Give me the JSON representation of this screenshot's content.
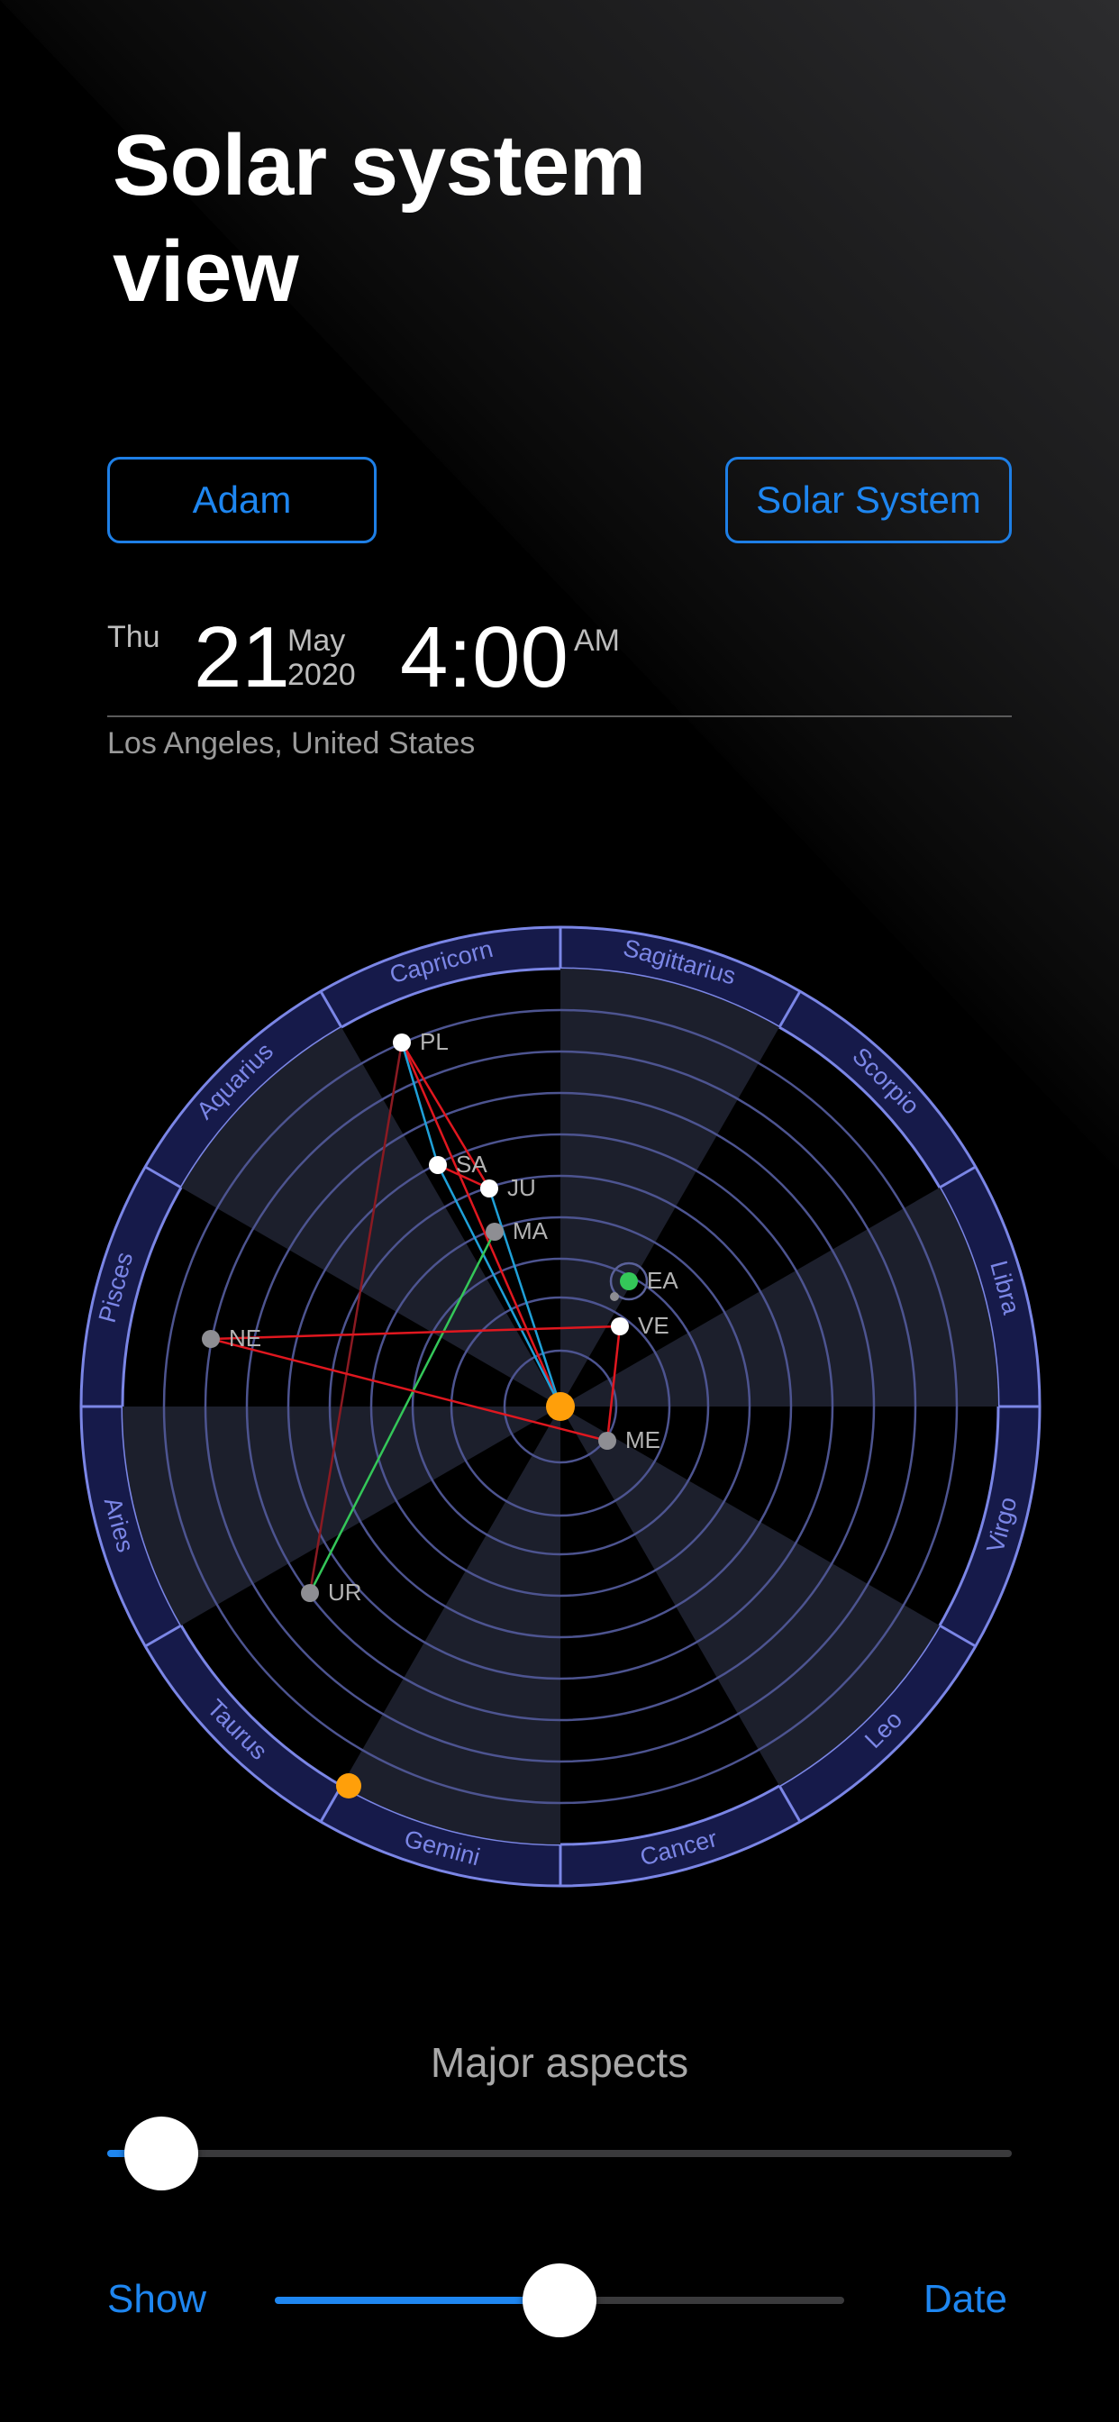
{
  "header": {
    "title_line1": "Solar system",
    "title_line2": "view"
  },
  "buttons": {
    "person": "Adam",
    "view_mode": "Solar System"
  },
  "datetime": {
    "weekday": "Thu",
    "day": "21",
    "month": "May",
    "year": "2020",
    "time": "4:00",
    "ampm": "AM"
  },
  "location": "Los Angeles, United States",
  "chart": {
    "zodiac": [
      "Capricorn",
      "Sagittarius",
      "Scorpio",
      "Libra",
      "Virgo",
      "Leo",
      "Cancer",
      "Gemini",
      "Taurus",
      "Aries",
      "Pisces",
      "Aquarius"
    ],
    "planets": [
      {
        "label": "PL",
        "color": "#ffffff"
      },
      {
        "label": "SA",
        "color": "#ffffff"
      },
      {
        "label": "JU",
        "color": "#ffffff"
      },
      {
        "label": "MA",
        "color": "#8e8e93"
      },
      {
        "label": "EA",
        "color": "#34c759"
      },
      {
        "label": "VE",
        "color": "#ffffff"
      },
      {
        "label": "NE",
        "color": "#8e8e93"
      },
      {
        "label": "ME",
        "color": "#8e8e93"
      },
      {
        "label": "UR",
        "color": "#8e8e93"
      }
    ],
    "colors": {
      "ring": "#7b86e6",
      "ring_fill": "#161a4a",
      "orbit": "#4d5490",
      "sector": "#1c1f2c",
      "sun": "#ff9f0a",
      "aspect_red": "#e0171f",
      "aspect_green": "#34c759",
      "aspect_blue": "#1fa0d8",
      "aspect_dark_red": "#8a1a22"
    }
  },
  "aspects": {
    "label": "Major aspects",
    "level": 0.06
  },
  "timeline": {
    "show_label": "Show",
    "date_label": "Date",
    "position": 0.5
  }
}
